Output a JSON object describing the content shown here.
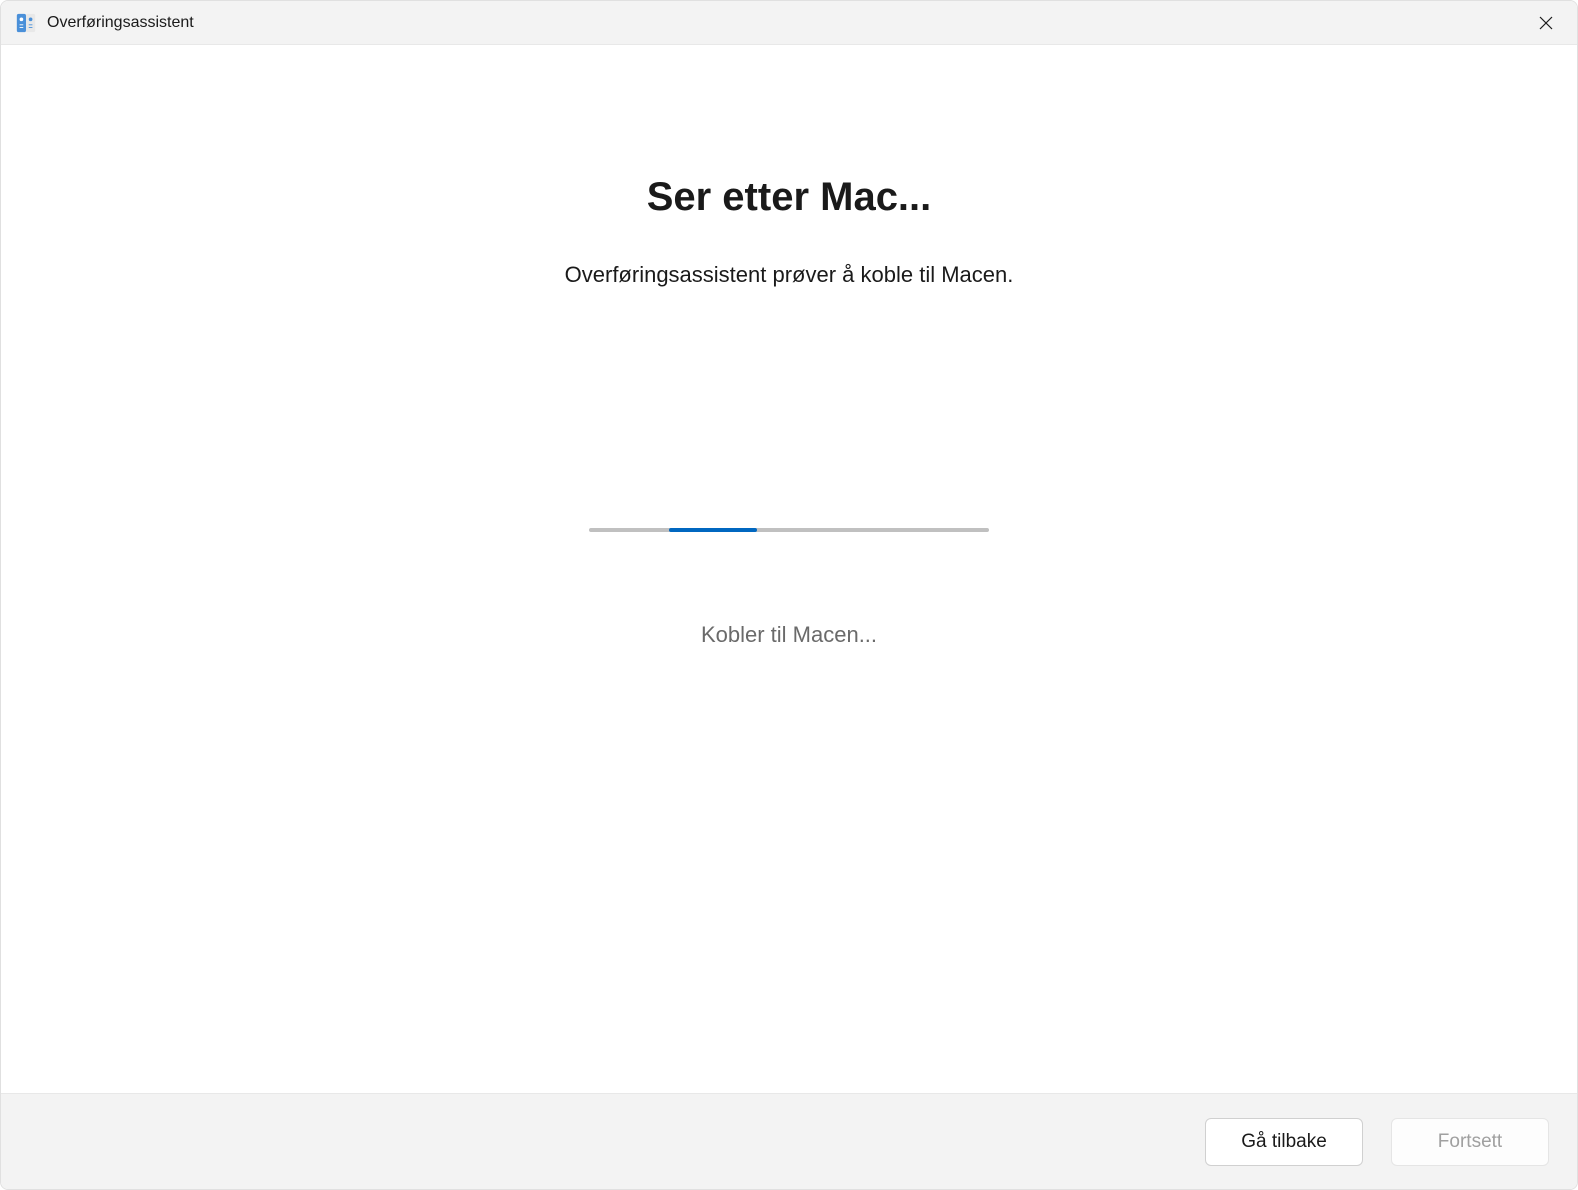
{
  "window": {
    "title": "Overføringsassistent"
  },
  "main": {
    "heading": "Ser etter Mac...",
    "subtitle": "Overføringsassistent prøver å koble til Macen.",
    "status_text": "Kobler til Macen..."
  },
  "footer": {
    "back_label": "Gå tilbake",
    "continue_label": "Fortsett"
  }
}
